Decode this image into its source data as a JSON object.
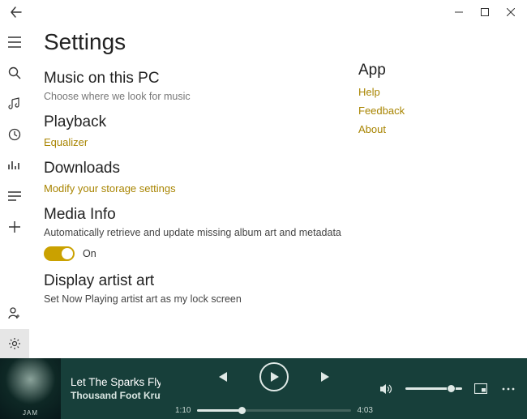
{
  "window": {
    "title": "Settings"
  },
  "page": {
    "title": "Settings"
  },
  "sections": {
    "music": {
      "head": "Music on this PC",
      "sub": "Choose where we look for music"
    },
    "playback": {
      "head": "Playback",
      "link": "Equalizer"
    },
    "downloads": {
      "head": "Downloads",
      "link": "Modify your storage settings"
    },
    "mediainfo": {
      "head": "Media Info",
      "body": "Automatically retrieve and update missing album art and metadata",
      "toggle": "On"
    },
    "artistart": {
      "head": "Display artist art",
      "body": "Set Now Playing artist art as my lock screen"
    }
  },
  "app": {
    "head": "App",
    "links": {
      "help": "Help",
      "feedback": "Feedback",
      "about": "About"
    }
  },
  "player": {
    "track": "Let The Sparks Fly",
    "artist": "Thousand Foot Krutch",
    "elapsed": "1:10",
    "total": "4:03"
  }
}
